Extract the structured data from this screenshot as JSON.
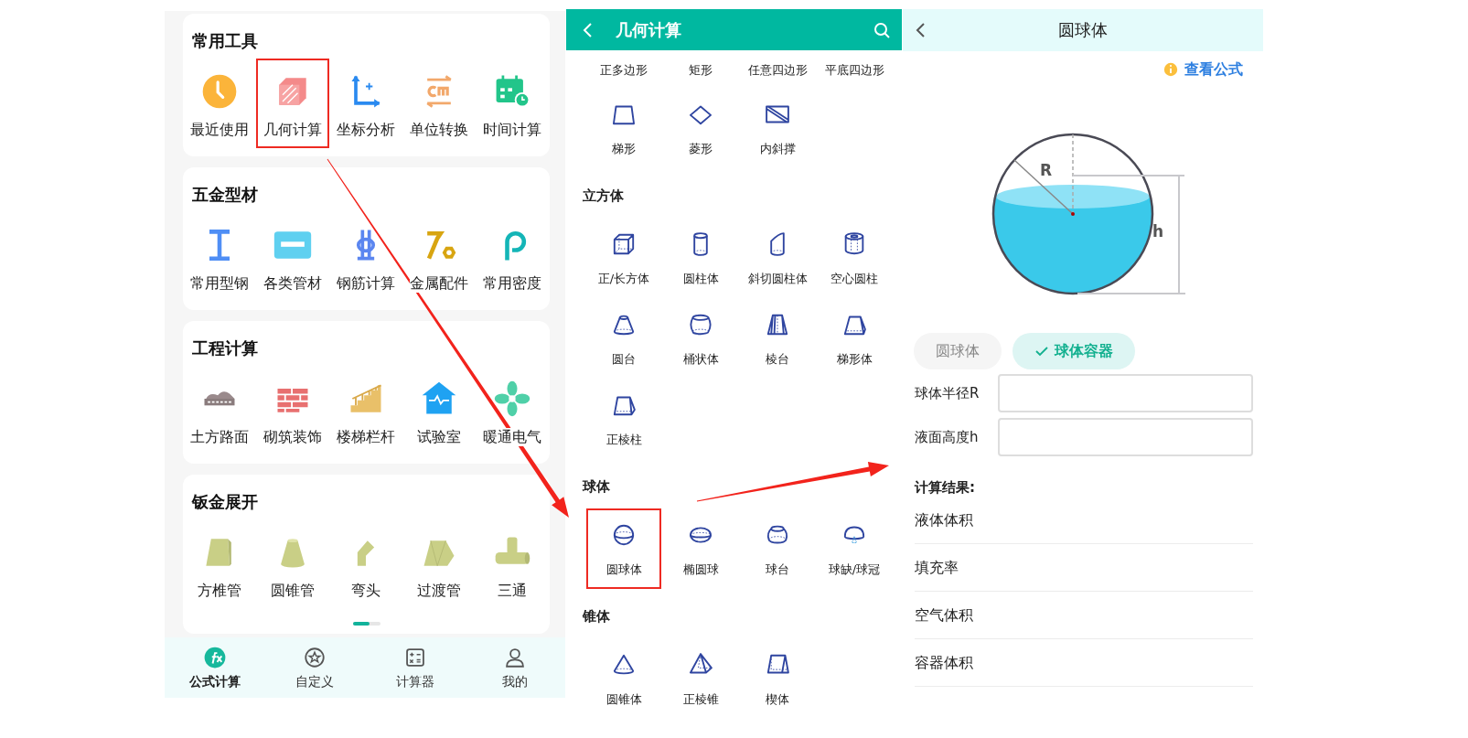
{
  "tool_sections": [
    {
      "title": "常用工具",
      "items": [
        {
          "label": "最近使用",
          "highlighted": false
        },
        {
          "label": "几何计算",
          "highlighted": true
        },
        {
          "label": "坐标分析",
          "highlighted": false
        },
        {
          "label": "单位转换",
          "highlighted": false
        },
        {
          "label": "时间计算",
          "highlighted": false
        }
      ]
    },
    {
      "title": "五金型材",
      "items": [
        {
          "label": "常用型钢",
          "highlighted": false
        },
        {
          "label": "各类管材",
          "highlighted": false
        },
        {
          "label": "钢筋计算",
          "highlighted": false
        },
        {
          "label": "金属配件",
          "highlighted": false
        },
        {
          "label": "常用密度",
          "highlighted": false
        }
      ]
    },
    {
      "title": "工程计算",
      "items": [
        {
          "label": "土方路面",
          "highlighted": false
        },
        {
          "label": "砌筑装饰",
          "highlighted": false
        },
        {
          "label": "楼梯栏杆",
          "highlighted": false
        },
        {
          "label": "试验室",
          "highlighted": false
        },
        {
          "label": "暖通电气",
          "highlighted": false
        }
      ]
    },
    {
      "title": "钣金展开",
      "items": [
        {
          "label": "方椎管",
          "highlighted": false
        },
        {
          "label": "圆锥管",
          "highlighted": false
        },
        {
          "label": "弯头",
          "highlighted": false
        },
        {
          "label": "过渡管",
          "highlighted": false
        },
        {
          "label": "三通",
          "highlighted": false
        }
      ]
    }
  ],
  "bottom_nav": [
    {
      "label": "公式计算",
      "selected": true
    },
    {
      "label": "自定义",
      "selected": false
    },
    {
      "label": "计算器",
      "selected": false
    },
    {
      "label": "我的",
      "selected": false
    }
  ],
  "geometry": {
    "title": "几何计算",
    "cut_row_labels": [
      "正多边形",
      "矩形",
      "任意四边形",
      "平底四边形"
    ],
    "groups": [
      {
        "items": [
          {
            "label": "梯形",
            "highlighted": false
          },
          {
            "label": "菱形",
            "highlighted": false
          },
          {
            "label": "内斜撑",
            "highlighted": false
          }
        ]
      },
      {
        "title": "立方体",
        "items": [
          {
            "label": "正/长方体",
            "highlighted": false
          },
          {
            "label": "圆柱体",
            "highlighted": false
          },
          {
            "label": "斜切圆柱体",
            "highlighted": false
          },
          {
            "label": "空心圆柱",
            "highlighted": false
          },
          {
            "label": "圆台",
            "highlighted": false
          },
          {
            "label": "桶状体",
            "highlighted": false
          },
          {
            "label": "棱台",
            "highlighted": false
          },
          {
            "label": "梯形体",
            "highlighted": false
          },
          {
            "label": "正棱柱",
            "highlighted": false
          }
        ]
      },
      {
        "title": "球体",
        "items": [
          {
            "label": "圆球体",
            "highlighted": true
          },
          {
            "label": "椭圆球",
            "highlighted": false
          },
          {
            "label": "球台",
            "highlighted": false
          },
          {
            "label": "球缺/球冠",
            "highlighted": false
          }
        ]
      },
      {
        "title": "锥体",
        "items": [
          {
            "label": "圆锥体",
            "highlighted": false
          },
          {
            "label": "正棱锥",
            "highlighted": false
          },
          {
            "label": "楔体",
            "highlighted": false
          }
        ]
      }
    ]
  },
  "sphere": {
    "title": "圆球体",
    "formula_link": "查看公式",
    "diagram": {
      "radius_label": "R",
      "height_label": "h"
    },
    "modes": [
      {
        "label": "圆球体",
        "selected": false
      },
      {
        "label": "球体容器",
        "selected": true
      }
    ],
    "inputs": [
      {
        "label": "球体半径R"
      },
      {
        "label": "液面高度h"
      }
    ],
    "results_title": "计算结果:",
    "results": [
      {
        "label": "液体体积"
      },
      {
        "label": "填充率"
      },
      {
        "label": "空气体积"
      },
      {
        "label": "容器体积"
      }
    ]
  }
}
